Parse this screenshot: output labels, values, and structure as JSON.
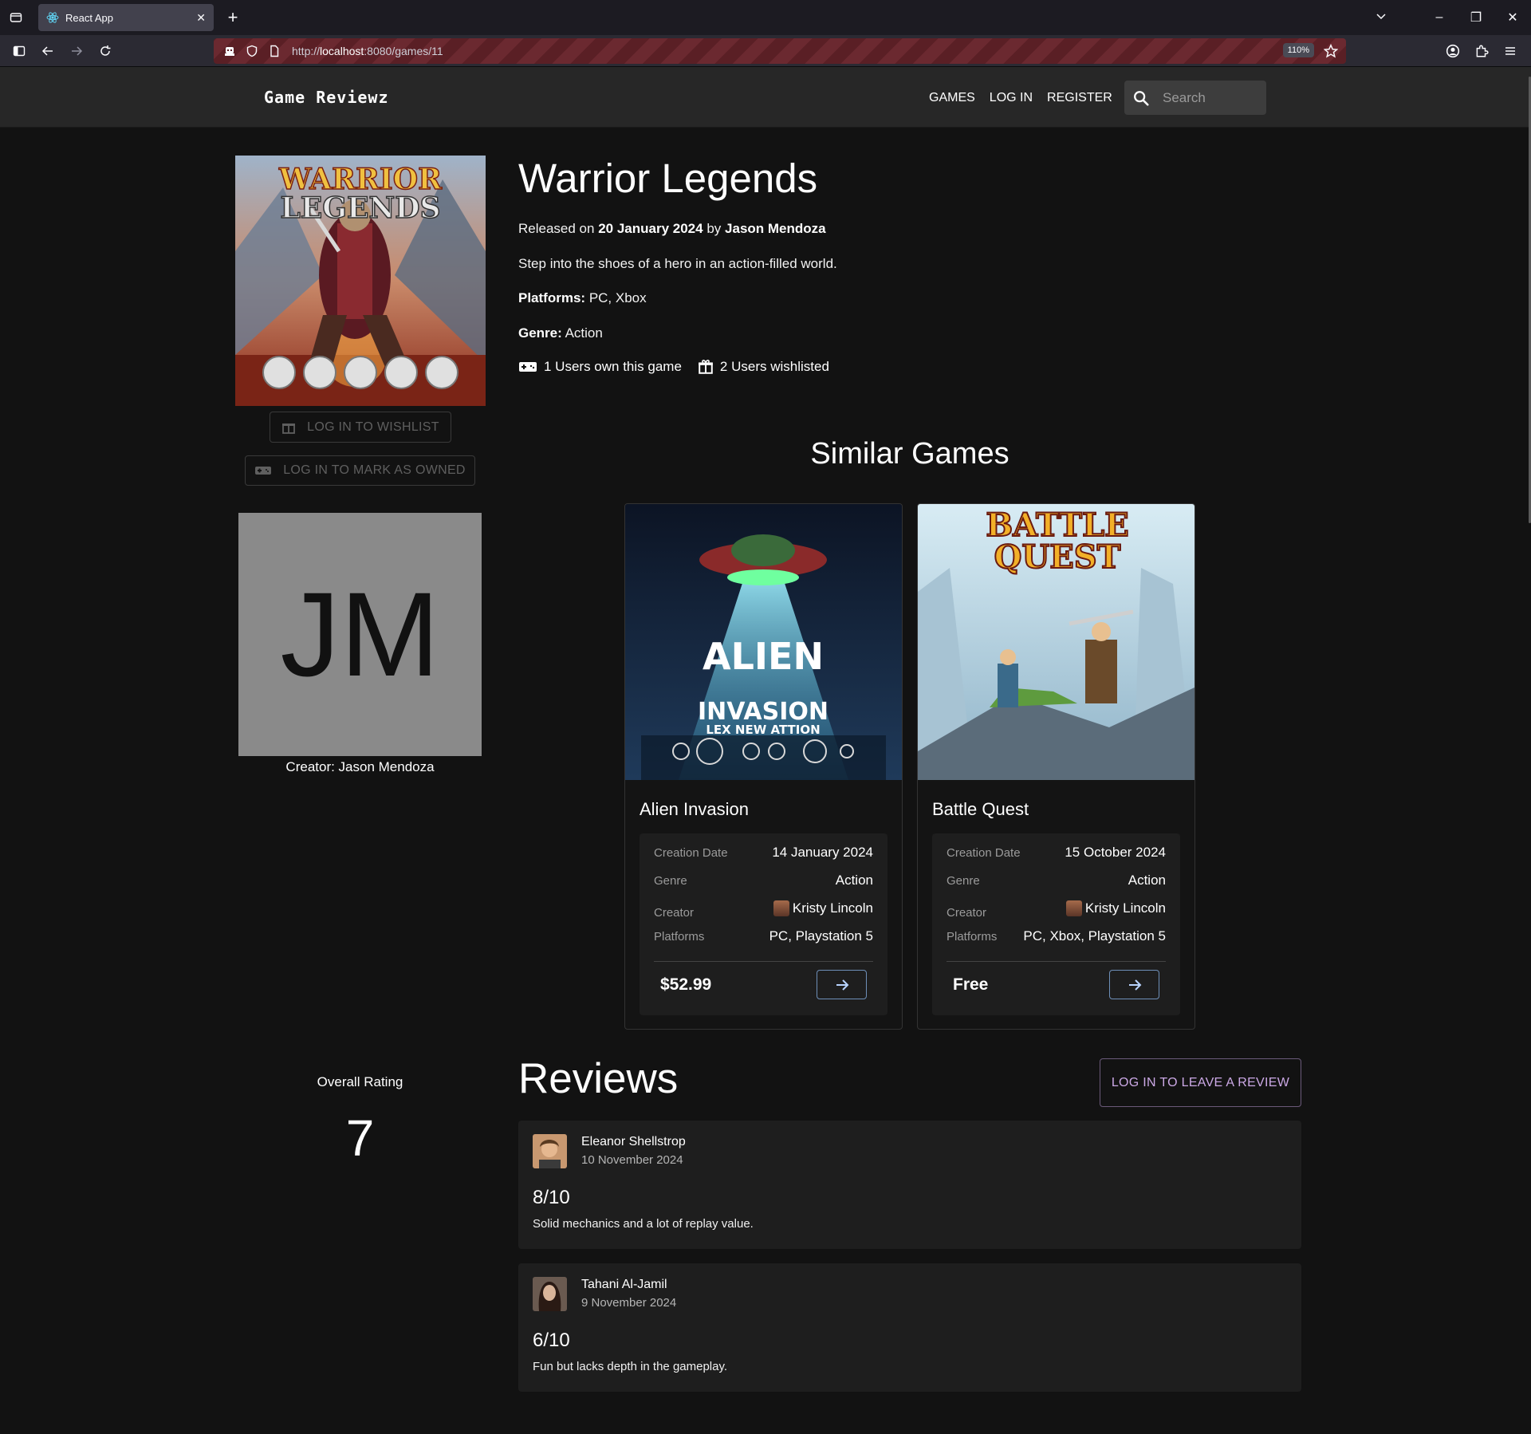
{
  "browser": {
    "tab_title": "React App",
    "url_prefix": "http://",
    "url_host": "localhost",
    "url_path": ":8080/games/11",
    "zoom": "110%"
  },
  "header": {
    "brand": "Game Reviewz",
    "nav": [
      "GAMES",
      "LOG IN",
      "REGISTER"
    ],
    "search_placeholder": "Search"
  },
  "game": {
    "title": "Warrior Legends",
    "released_prefix": "Released on",
    "release_date": "20 January 2024",
    "by": "by",
    "creator": "Jason Mendoza",
    "description": "Step into the shoes of a hero in an action-filled world.",
    "platforms_label": "Platforms:",
    "platforms": "PC, Xbox",
    "genre_label": "Genre:",
    "genre": "Action",
    "owned_text": "1 Users own this game",
    "wishlisted_text": "2 Users wishlisted",
    "cover_title_1": "WARRIOR",
    "cover_title_2": "LEGENDS"
  },
  "actions": {
    "wishlist_label": "LOG IN TO WISHLIST",
    "owned_label": "LOG IN TO MARK AS OWNED"
  },
  "creator_card": {
    "initials": "JM",
    "caption": "Creator: Jason Mendoza"
  },
  "similar": {
    "title": "Similar Games",
    "labels": {
      "date": "Creation Date",
      "genre": "Genre",
      "creator": "Creator",
      "platforms": "Platforms"
    },
    "games": [
      {
        "name": "Alien Invasion",
        "cover_line_1": "ALIEN",
        "cover_line_2": "INVASION",
        "cover_line_3": "LEX NEW ATTION",
        "date": "14 January 2024",
        "genre": "Action",
        "creator": "Kristy Lincoln",
        "platforms": "PC, Playstation 5",
        "price": "$52.99"
      },
      {
        "name": "Battle Quest",
        "cover_line_1": "BATTLE",
        "cover_line_2": "QUEST",
        "date": "15 October 2024",
        "genre": "Action",
        "creator": "Kristy Lincoln",
        "platforms": "PC, Xbox, Playstation 5",
        "price": "Free"
      }
    ]
  },
  "reviews": {
    "overall_label": "Overall Rating",
    "overall_value": "7",
    "title": "Reviews",
    "leave_review_label": "LOG IN TO LEAVE A REVIEW",
    "items": [
      {
        "author": "Eleanor Shellstrop",
        "date": "10 November 2024",
        "score": "8/10",
        "text": "Solid mechanics and a lot of replay value."
      },
      {
        "author": "Tahani Al-Jamil",
        "date": "9 November 2024",
        "score": "6/10",
        "text": "Fun but lacks depth in the gameplay."
      }
    ]
  }
}
